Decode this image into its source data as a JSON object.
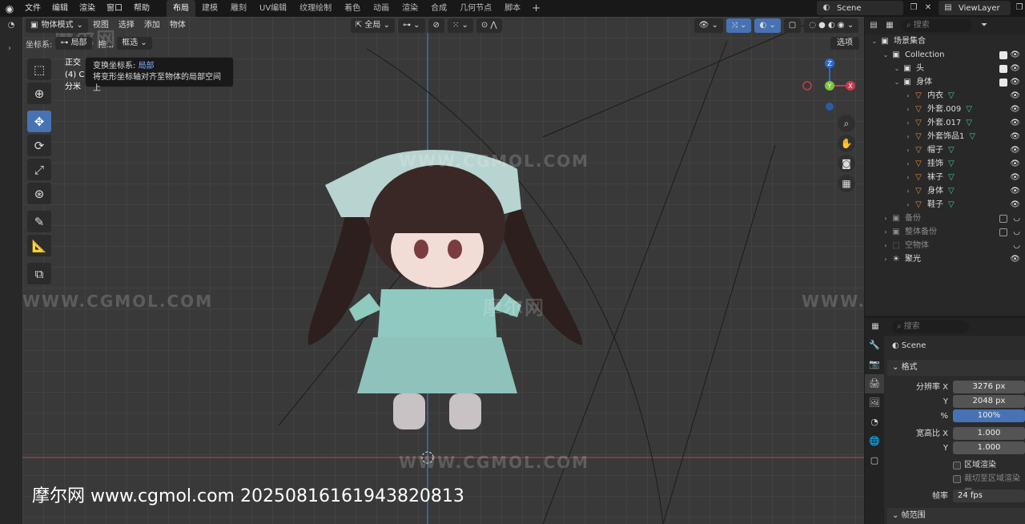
{
  "topbar": {
    "menus": [
      "文件",
      "编辑",
      "渲染",
      "窗口",
      "帮助"
    ],
    "workspaces": [
      "布局",
      "建模",
      "雕刻",
      "UV编辑",
      "纹理绘制",
      "着色",
      "动画",
      "渲染",
      "合成",
      "几何节点",
      "脚本"
    ],
    "active_workspace": "布局",
    "add_tab": "+",
    "scene": "Scene",
    "view_layer": "ViewLayer"
  },
  "viewport": {
    "mode": "物体模式",
    "menus": [
      "视图",
      "选择",
      "添加",
      "物体"
    ],
    "transform_orientation": "全局",
    "sub_label": "坐标系:",
    "sub_value": "局部",
    "drag_label": "拖...",
    "drag_value": "框选",
    "options": "选项",
    "overlay_lines": [
      "正交",
      "(4) Co",
      "分米"
    ],
    "tooltip": {
      "title": "变换坐标系:",
      "value": "局部",
      "desc": "将变形坐标轴对齐至物体的局部空间上"
    },
    "gizmo": {
      "x": "X",
      "y": "Y",
      "z": "Z"
    },
    "watermark": "WWW.CGMOL.COM",
    "watermark_cn": "摩尔网",
    "footer": "摩尔网 www.cgmol.com 20250816161943820813"
  },
  "outliner": {
    "search_placeholder": "搜索",
    "rows": [
      {
        "label": "场景集合",
        "level": 0,
        "kind": "collection",
        "dim": false
      },
      {
        "label": "Collection",
        "level": 1,
        "kind": "collection",
        "dim": false
      },
      {
        "label": "头",
        "level": 2,
        "kind": "collection",
        "dim": false
      },
      {
        "label": "身体",
        "level": 2,
        "kind": "collection",
        "dim": false
      },
      {
        "label": "内衣",
        "level": 3,
        "kind": "mesh",
        "dim": false
      },
      {
        "label": "外套.009",
        "level": 3,
        "kind": "mesh",
        "dim": false
      },
      {
        "label": "外套.017",
        "level": 3,
        "kind": "mesh",
        "dim": false
      },
      {
        "label": "外套饰品1",
        "level": 3,
        "kind": "mesh",
        "dim": false
      },
      {
        "label": "帽子",
        "level": 3,
        "kind": "mesh",
        "dim": false
      },
      {
        "label": "挂饰",
        "level": 3,
        "kind": "mesh",
        "dim": false
      },
      {
        "label": "袜子",
        "level": 3,
        "kind": "mesh",
        "dim": false
      },
      {
        "label": "身体",
        "level": 3,
        "kind": "mesh",
        "dim": false
      },
      {
        "label": "鞋子",
        "level": 3,
        "kind": "mesh",
        "dim": false
      },
      {
        "label": "备份",
        "level": 1,
        "kind": "collection",
        "dim": true
      },
      {
        "label": "整体备份",
        "level": 1,
        "kind": "collection",
        "dim": true
      },
      {
        "label": "空物体",
        "level": 1,
        "kind": "empty",
        "dim": true
      },
      {
        "label": "聚光",
        "level": 1,
        "kind": "light",
        "dim": false
      }
    ]
  },
  "properties": {
    "search_placeholder": "搜索",
    "scene_name": "Scene",
    "panel_format": "格式",
    "resolution_x_label": "分辨率 X",
    "resolution_x": "3276 px",
    "resolution_y_label": "Y",
    "resolution_y": "2048 px",
    "percent_label": "%",
    "percent": "100%",
    "aspect_x_label": "宽高比 X",
    "aspect_x": "1.000",
    "aspect_y_label": "Y",
    "aspect_y": "1.000",
    "render_region": "区域渲染",
    "crop_region": "裁切至区域渲染框",
    "fps_label": "帧率",
    "fps": "24 fps",
    "frame_range": "帧范围"
  }
}
